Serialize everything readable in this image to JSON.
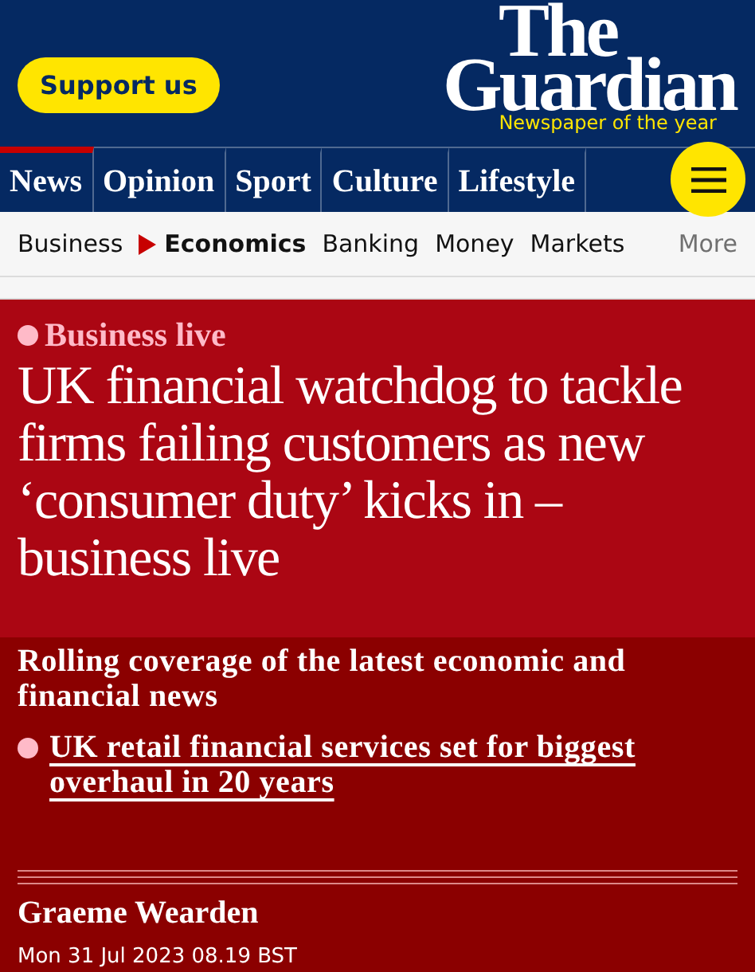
{
  "header": {
    "support_button": "Support us",
    "logo_line1": "The",
    "logo_line2": "Guardian",
    "tagline": "Newspaper of the year"
  },
  "nav": {
    "items": [
      {
        "label": "News",
        "selected": true
      },
      {
        "label": "Opinion",
        "selected": false
      },
      {
        "label": "Sport",
        "selected": false
      },
      {
        "label": "Culture",
        "selected": false
      },
      {
        "label": "Lifestyle",
        "selected": false
      }
    ]
  },
  "subnav": {
    "items": [
      {
        "label": "Business",
        "selected": false
      },
      {
        "label": "Economics",
        "selected": true
      },
      {
        "label": "Banking",
        "selected": false
      },
      {
        "label": "Money",
        "selected": false
      },
      {
        "label": "Markets",
        "selected": false
      }
    ],
    "more": "More"
  },
  "article": {
    "series": "Business live",
    "headline": "UK financial watchdog to tackle firms failing customers as new ‘consumer duty’ kicks in – business live",
    "standfirst": "Rolling coverage of the latest economic and financial news",
    "bullets": [
      "UK retail financial services set for biggest overhaul in 20 years"
    ],
    "byline": "Graeme Wearden",
    "date": "Mon 31 Jul 2023 08.19 BST"
  }
}
